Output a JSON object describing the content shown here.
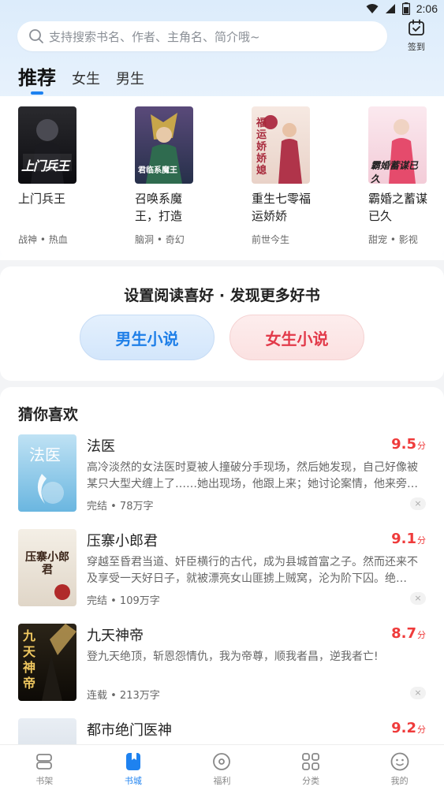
{
  "status": {
    "time": "2:06"
  },
  "search": {
    "placeholder": "支持搜索书名、作者、主角名、简介哦~"
  },
  "signin": {
    "label": "签到"
  },
  "tabs": [
    {
      "label": "推荐",
      "active": true
    },
    {
      "label": "女生",
      "active": false
    },
    {
      "label": "男生",
      "active": false
    }
  ],
  "recommend": [
    {
      "title": "上门兵王",
      "tags": "战神 • 热血",
      "cover_text": "上门兵王"
    },
    {
      "title": "召唤系魔王，打造",
      "tags": "脑洞 • 奇幻",
      "cover_text": "君临系魔王"
    },
    {
      "title": "重生七零福运娇娇",
      "tags": "前世今生",
      "cover_text": "福运娇娇媳"
    },
    {
      "title": "霸婚之蓄谋已久",
      "tags": "甜宠 • 影视",
      "cover_text": "霸婚蓄谋已久"
    }
  ],
  "preference": {
    "title": "设置阅读喜好 · 发现更多好书",
    "male_label": "男生小说",
    "female_label": "女生小说"
  },
  "guess": {
    "heading": "猜你喜欢",
    "books": [
      {
        "title": "法医",
        "score": "9.5",
        "unit": "分",
        "desc": "高冷淡然的女法医时夏被人撞破分手现场，然后她发现，自己好像被某只大型犬缠上了……她出现场，他跟上来；她讨论案情，他来旁…",
        "meta": "完结 • 78万字",
        "cover_text": "法医"
      },
      {
        "title": "压寨小郎君",
        "score": "9.1",
        "unit": "分",
        "desc": "穿越至昏君当道、奸臣横行的古代，成为县城首富之子。然而还来不及享受一天好日子，就被漂亮女山匪掳上贼窝，沦为阶下囚。绝…",
        "meta": "完结 • 109万字",
        "cover_text": "压寨小郎君"
      },
      {
        "title": "九天神帝",
        "score": "8.7",
        "unit": "分",
        "desc": "登九天绝顶，斩恩怨情仇，我为帝尊，顺我者昌，逆我者亡!",
        "meta": "连载 • 213万字",
        "cover_text": "九天神帝"
      },
      {
        "title": "都市绝门医神",
        "score": "9.2",
        "unit": "分",
        "desc": "",
        "meta": "",
        "cover_text": ""
      }
    ],
    "dismiss": "×"
  },
  "nav": [
    {
      "label": "书架",
      "icon": "bookshelf-icon",
      "active": false
    },
    {
      "label": "书城",
      "icon": "bookstore-icon",
      "active": true
    },
    {
      "label": "福利",
      "icon": "welfare-icon",
      "active": false
    },
    {
      "label": "分类",
      "icon": "category-icon",
      "active": false
    },
    {
      "label": "我的",
      "icon": "profile-icon",
      "active": false
    }
  ],
  "colors": {
    "accent": "#1e82f0",
    "score": "#ef3b3b",
    "female": "#e23a4a"
  }
}
